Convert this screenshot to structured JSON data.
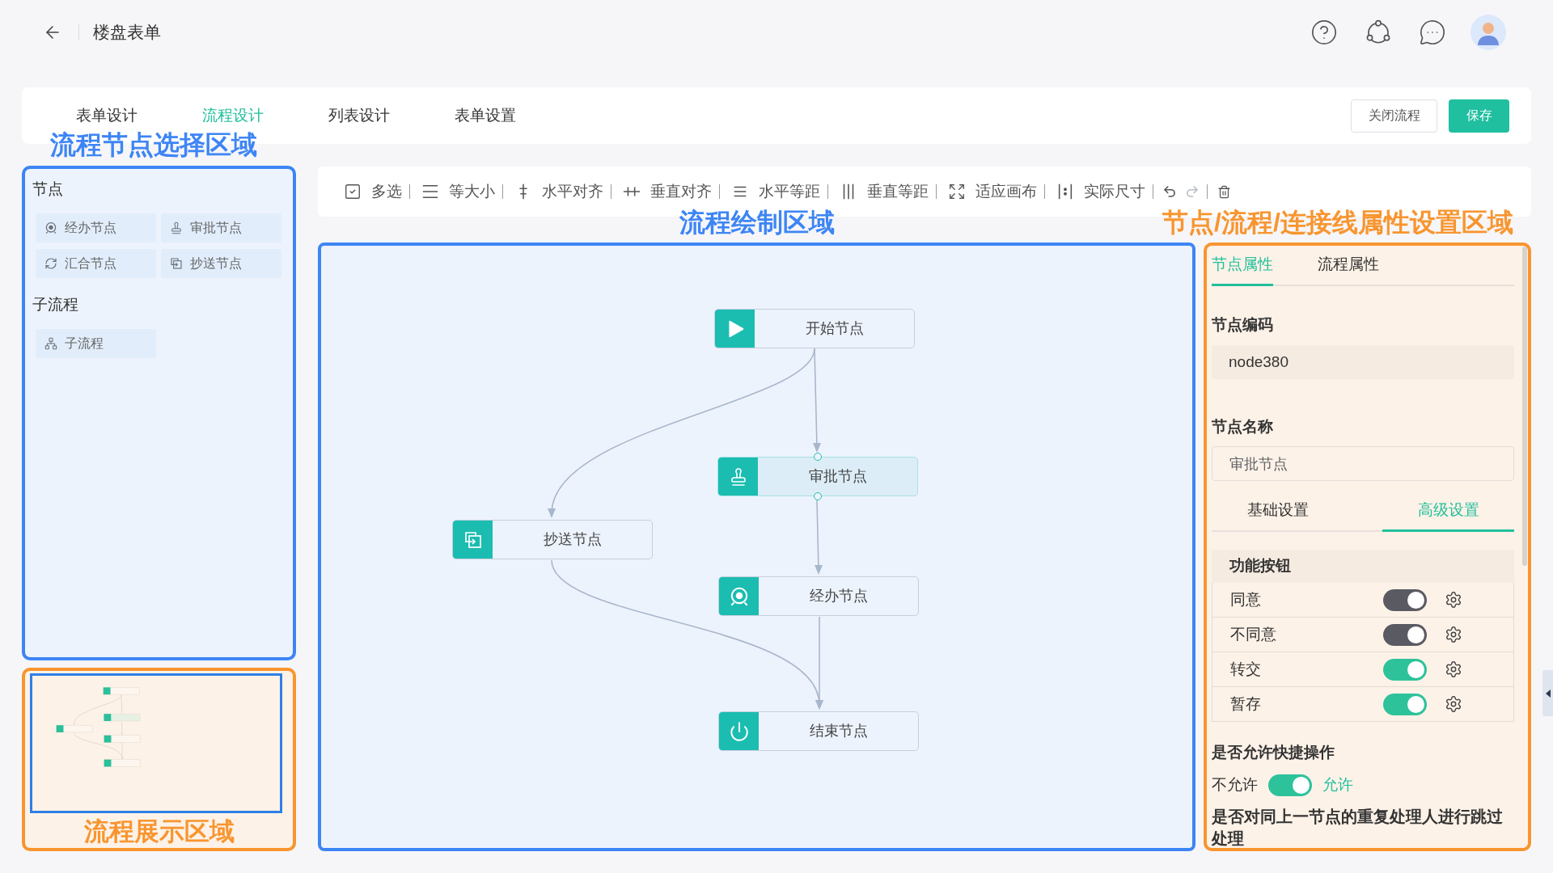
{
  "header": {
    "title": "楼盘表单"
  },
  "tabs": [
    {
      "label": "表单设计",
      "selected": false
    },
    {
      "label": "流程设计",
      "selected": true
    },
    {
      "label": "列表设计",
      "selected": false
    },
    {
      "label": "表单设置",
      "selected": false
    }
  ],
  "actions": [
    {
      "label": "关闭流程",
      "kind": "secondary"
    },
    {
      "label": "保存",
      "kind": "primary"
    }
  ],
  "annotations": [
    {
      "label": "流程节点选择区域",
      "color": "#3d85f5"
    },
    {
      "label": "流程绘制区域",
      "color": "#3d85f5"
    },
    {
      "label": "节点/流程/连接线属性设置区域",
      "color": "#f8952f"
    },
    {
      "label": "流程展示区域",
      "color": "#f8952f"
    }
  ],
  "palette": {
    "sections": [
      {
        "title": "节点",
        "items": [
          {
            "label": "经办节点",
            "kind": "handle"
          },
          {
            "label": "审批节点",
            "kind": "approve"
          },
          {
            "label": "汇合节点",
            "kind": "merge"
          },
          {
            "label": "抄送节点",
            "kind": "copy"
          }
        ]
      },
      {
        "title": "子流程",
        "items": [
          {
            "label": "子流程",
            "kind": "subflow"
          }
        ]
      }
    ]
  },
  "toolbar": {
    "items": [
      {
        "label": "多选",
        "kind": "multi-select"
      },
      {
        "label": "等大小",
        "kind": "same-size"
      },
      {
        "label": "水平对齐",
        "kind": "align-horizontal"
      },
      {
        "label": "垂直对齐",
        "kind": "align-vertical"
      },
      {
        "label": "水平等距",
        "kind": "space-horizontal"
      },
      {
        "label": "垂直等距",
        "kind": "space-vertical"
      },
      {
        "label": "适应画布",
        "kind": "fit-canvas"
      },
      {
        "label": "实际尺寸",
        "kind": "actual-size"
      }
    ],
    "history": [
      {
        "kind": "undo",
        "disabled": false
      },
      {
        "kind": "redo",
        "disabled": true
      }
    ]
  },
  "canvas": {
    "nodes": [
      {
        "label": "开始节点",
        "kind": "start",
        "selected": false
      },
      {
        "label": "审批节点",
        "kind": "approve",
        "selected": true
      },
      {
        "label": "抄送节点",
        "kind": "copy",
        "selected": false
      },
      {
        "label": "经办节点",
        "kind": "handle",
        "selected": false
      },
      {
        "label": "结束节点",
        "kind": "end",
        "selected": false
      }
    ]
  },
  "properties": {
    "tabs": [
      {
        "label": "节点属性",
        "selected": true
      },
      {
        "label": "流程属性",
        "selected": false
      }
    ],
    "fields": [
      {
        "label": "节点编码",
        "value": "node380",
        "disabled": true
      },
      {
        "label": "节点名称",
        "value": "审批节点",
        "disabled": false
      }
    ],
    "sub_tabs": [
      {
        "label": "基础设置",
        "selected": false
      },
      {
        "label": "高级设置",
        "selected": true
      }
    ],
    "buttons_table": {
      "title": "功能按钮",
      "rows": [
        {
          "label": "同意",
          "on": true,
          "disabled": true
        },
        {
          "label": "不同意",
          "on": true,
          "disabled": true
        },
        {
          "label": "转交",
          "on": true,
          "disabled": false
        },
        {
          "label": "暂存",
          "on": true,
          "disabled": false
        }
      ]
    },
    "quick_action": {
      "title": "是否允许快捷操作",
      "off_label": "不允许",
      "on_label": "允许",
      "on": true
    },
    "skip_title": "是否对同上一节点的重复处理人进行跳过处理"
  }
}
